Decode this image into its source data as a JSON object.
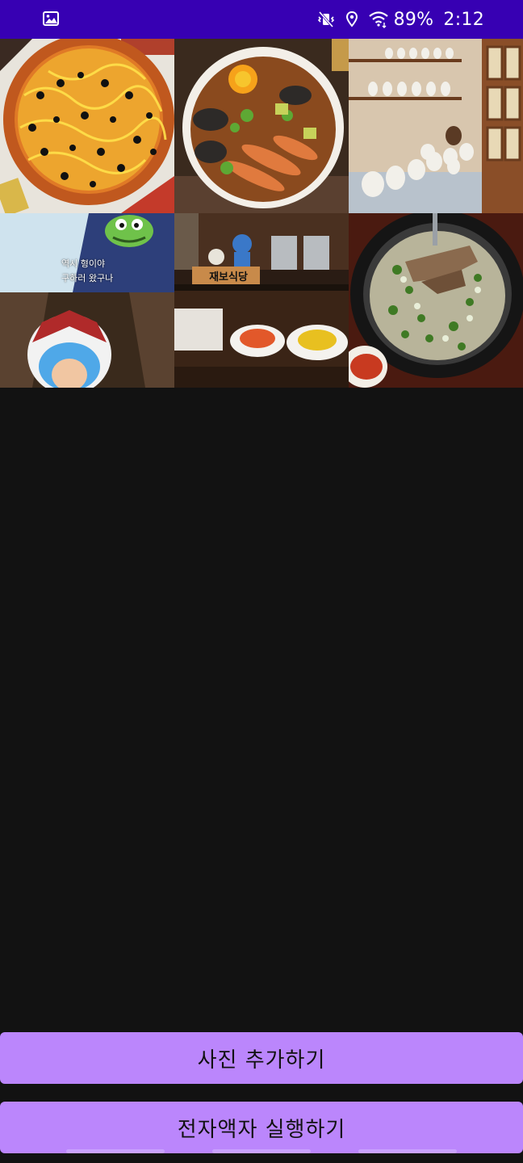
{
  "status_bar": {
    "left_icon": "gallery-icon",
    "icons": [
      "vibrate-mute-icon",
      "location-icon",
      "wifi-icon"
    ],
    "battery": "89%",
    "time": "2:12",
    "background": "#3700b3"
  },
  "photos": [
    {
      "name": "photo-pizza",
      "caption_lines": []
    },
    {
      "name": "photo-seafood-platter",
      "caption_lines": []
    },
    {
      "name": "photo-ceramic-shelves",
      "caption_lines": []
    },
    {
      "name": "photo-cartoon-screenshot",
      "caption_lines": [
        "역시 형이야",
        "구하러 왔구나"
      ]
    },
    {
      "name": "photo-restaurant-counter",
      "sign_text": "재보식당"
    },
    {
      "name": "photo-soup-bowl",
      "caption_lines": []
    }
  ],
  "buttons": {
    "add_photo": "사진 추가하기",
    "run_frame": "전자액자 실행하기"
  },
  "colors": {
    "accent": "#bb86fc",
    "background": "#121212"
  }
}
